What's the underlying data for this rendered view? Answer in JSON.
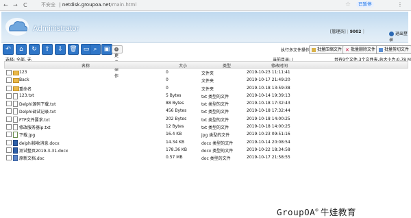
{
  "browser": {
    "back": "←",
    "forward": "→",
    "reload": "C",
    "security": "不安全",
    "host": "netdisk.groupoa.net",
    "path": "/main.html",
    "paused": "已暂停",
    "menu": "⋮"
  },
  "header": {
    "title": "Administrator",
    "user_label": "[管理员]",
    "user_id": "9002",
    "logout": "退出登录"
  },
  "toolbar": {
    "icons": [
      "back-icon",
      "home-icon",
      "refresh-icon",
      "upload-icon",
      "download-icon",
      "delete-icon",
      "folder-icon",
      "search-icon",
      "image-icon"
    ],
    "more_label": "更多操作"
  },
  "batch": {
    "label": "执行多文件操作:",
    "compress": "批量压缩文件",
    "delete": "批量删除文件",
    "cut": "批量剪切文件"
  },
  "status": {
    "selection": "选择: 全部, 无",
    "current_dir": "当前目录: /",
    "summary": "共有9个文件,3个文件夹,总大小为:0.78 MB"
  },
  "table": {
    "columns": [
      "名称",
      "大小",
      "类型",
      "修改时间"
    ],
    "rows": [
      {
        "name": "123",
        "size": "0",
        "type": "文件夹",
        "modified": "2019-10-23 11:11:41",
        "icon": "folder"
      },
      {
        "name": "Back",
        "size": "0",
        "type": "文件夹",
        "modified": "2019-10-17 21:49:20",
        "icon": "folder"
      },
      {
        "name": "重命名",
        "size": "0",
        "type": "文件夹",
        "modified": "2019-10-18 13:59:38",
        "icon": "folder"
      },
      {
        "name": "123.txt",
        "size": "5 Bytes",
        "type": "txt 类型的文件",
        "modified": "2019-10-14 19:39:13",
        "icon": "txt"
      },
      {
        "name": "Delphi源码下载.txt",
        "size": "88 Bytes",
        "type": "txt 类型的文件",
        "modified": "2019-10-18 17:32:43",
        "icon": "txt"
      },
      {
        "name": "Delphi调试记录.txt",
        "size": "456 Bytes",
        "type": "txt 类型的文件",
        "modified": "2019-10-18 17:32:44",
        "icon": "txt"
      },
      {
        "name": "FTP文件要求.txt",
        "size": "202 Bytes",
        "type": "txt 类型的文件",
        "modified": "2019-10-18 14:00:25",
        "icon": "txt"
      },
      {
        "name": "修改服务器ip.txt",
        "size": "12 Bytes",
        "type": "txt 类型的文件",
        "modified": "2019-10-18 14:00:25",
        "icon": "txt"
      },
      {
        "name": "下载.jpg",
        "size": "16.4 KB",
        "type": "jpg 类型的文件",
        "modified": "2019-10-23 09:51:16",
        "icon": "img"
      },
      {
        "name": "delphi接收消息.docx",
        "size": "14.34 KB",
        "type": "docx 类型的文件",
        "modified": "2019-10-14 20:08:54",
        "icon": "docx"
      },
      {
        "name": "测试整页2019-3-31.docx",
        "size": "178.36 KB",
        "type": "docx 类型的文件",
        "modified": "2019-10-22 18:34:58",
        "icon": "docx"
      },
      {
        "name": "原新文档.doc",
        "size": "0.57 MB",
        "type": "doc 类型的文件",
        "modified": "2019-10-17 21:58:55",
        "icon": "doc"
      }
    ]
  },
  "watermark": {
    "brand": "GroupOA",
    "reg": "®",
    "tagline": "牛娃教育"
  }
}
